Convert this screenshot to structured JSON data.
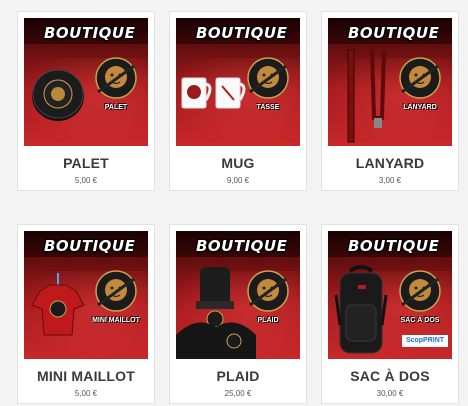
{
  "products": [
    {
      "banner": "BOUTIQUE",
      "logo_label": "PALET",
      "name": "PALET",
      "price": "5,00 €"
    },
    {
      "banner": "BOUTIQUE",
      "logo_label": "TASSE",
      "name": "MUG",
      "price": "9,00 €"
    },
    {
      "banner": "BOUTIQUE",
      "logo_label": "LANYARD",
      "name": "LANYARD",
      "price": "3,00 €"
    },
    {
      "banner": "BOUTIQUE",
      "logo_label": "MINI MAILLOT",
      "name": "MINI MAILLOT",
      "price": "5,00 €"
    },
    {
      "banner": "BOUTIQUE",
      "logo_label": "PLAID",
      "name": "PLAID",
      "price": "25,00 €"
    },
    {
      "banner": "BOUTIQUE",
      "logo_label": "SAC À DOS",
      "name": "SAC À DOS",
      "price": "30,00 €",
      "sponsor": "ScopPRINT"
    }
  ],
  "colors": {
    "brand_red": "#b21e20",
    "dark_band": "#2a0404",
    "background": "#f3f3f3"
  },
  "icons": [
    "lion-logo-icon",
    "hockey-puck-icon",
    "mug-icon",
    "lanyard-icon",
    "mini-jersey-icon",
    "plaid-blanket-icon",
    "backpack-icon"
  ]
}
